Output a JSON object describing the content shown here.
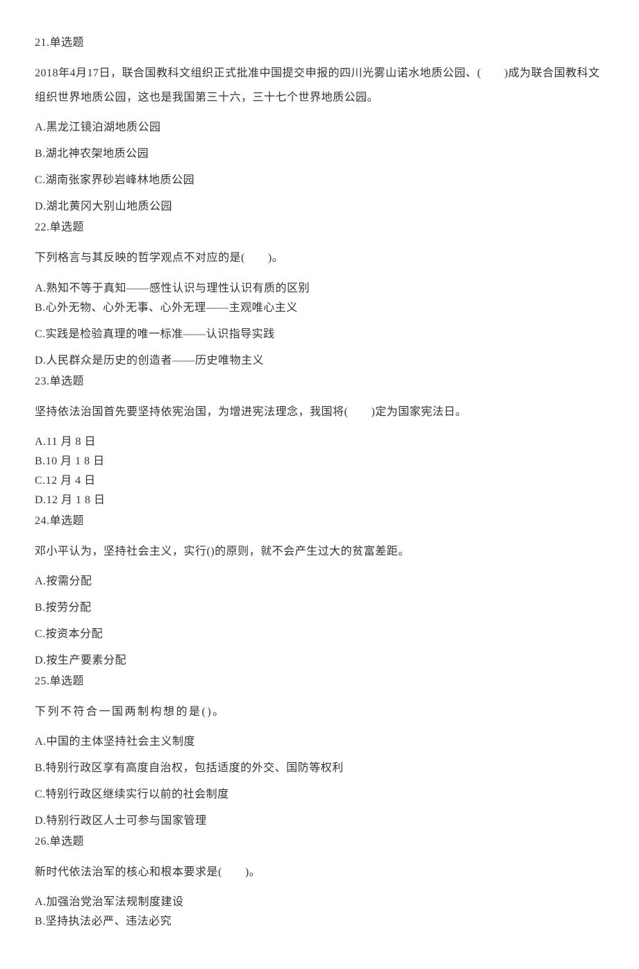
{
  "questions": [
    {
      "header": "21.单选题",
      "stem": "2018年4月17日，联合国教科文组织正式批准中国提交申报的四川光雾山诺水地质公园、(　　)成为联合国教科文组织世界地质公园，这也是我国第三十六，三十七个世界地质公园。",
      "options": [
        "A.黑龙江镜泊湖地质公园",
        "B.湖北神农架地质公园",
        "C.湖南张家界砂岩峰林地质公园",
        "D.湖北黄冈大别山地质公园"
      ]
    },
    {
      "header": "22.单选题",
      "stem": "下列格言与其反映的哲学观点不对应的是(　　)。",
      "options": [
        "A.熟知不等于真知——感性认识与理性认识有质的区别",
        "B.心外无物、心外无事、心外无理——主观唯心主义",
        "C.实践是检验真理的唯一标准——认识指导实践",
        "D.人民群众是历史的创造者——历史唯物主义"
      ]
    },
    {
      "header": "23.单选题",
      "stem": "坚持依法治国首先要坚持依宪治国，为增进宪法理念，我国将(　　)定为国家宪法日。",
      "options": [
        "A.11 月 8 日",
        "B.10 月 1 8 日",
        "C.12 月 4 日",
        "D.12 月 1 8 日"
      ]
    },
    {
      "header": "24.单选题",
      "stem": "邓小平认为，坚持社会主义，实行()的原则，就不会产生过大的贫富差距。",
      "options": [
        "A.按需分配",
        "B.按劳分配",
        "C.按资本分配",
        "D.按生产要素分配"
      ]
    },
    {
      "header": "25.单选题",
      "stem": "下列不符合一国两制构想的是()。",
      "stem_spaced": true,
      "options": [
        "A.中国的主体坚持社会主义制度",
        "B.特别行政区享有高度自治权，包括适度的外交、国防等权利",
        "C.特别行政区继续实行以前的社会制度",
        "D.特别行政区人士可参与国家管理"
      ]
    },
    {
      "header": "26.单选题",
      "stem": "新时代依法治军的核心和根本要求是(　　)。",
      "options": [
        "A.加强治党治军法规制度建设",
        "B.坚持执法必严、违法必究"
      ]
    }
  ]
}
